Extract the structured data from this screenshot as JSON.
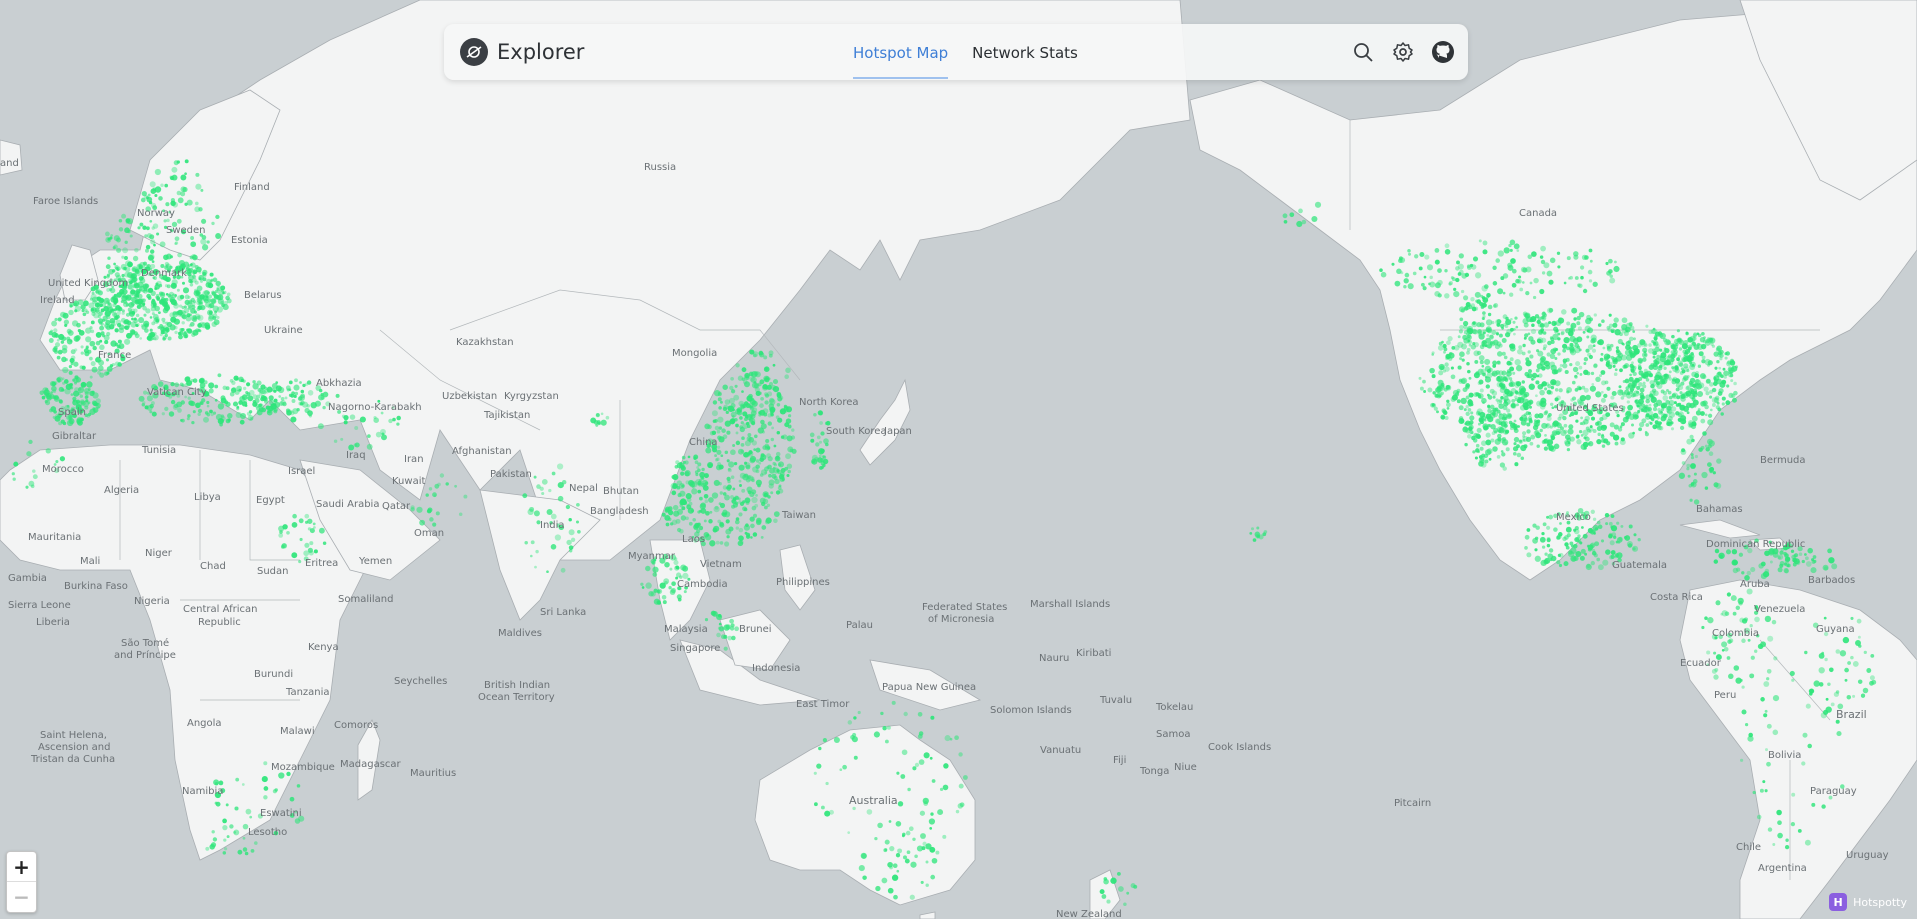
{
  "app": {
    "title": "Explorer",
    "tabs": [
      {
        "label": "Hotspot Map",
        "active": true
      },
      {
        "label": "Network Stats",
        "active": false
      }
    ],
    "actions": [
      "search-icon",
      "gear-icon",
      "github-icon"
    ]
  },
  "colors": {
    "ocean": "#c9cfd2",
    "land": "#f3f4f4",
    "border": "#a9aeb2",
    "hotspot": "#2ee57a",
    "accent": "#3f7fd6"
  },
  "zoom": {
    "in_label": "+",
    "out_label": "−"
  },
  "attribution": {
    "logo_letter": "H",
    "text": "Hotspotty"
  },
  "place_labels": {
    "russia": "Russia",
    "canada": "Canada",
    "faroe": "Faroe Islands",
    "finland": "Finland",
    "norway": "Norway",
    "sweden": "Sweden",
    "estonia": "Estonia",
    "uk": "United Kingdom",
    "ireland": "Ireland",
    "denmark": "Denmark",
    "belarus": "Belarus",
    "ukraine": "Ukraine",
    "france": "France",
    "spain": "Spain",
    "abkhazia": "Abkhazia",
    "nagorno": "Nagorno-Karabakh",
    "kazakhstan": "Kazakhstan",
    "mongolia": "Mongolia",
    "uzbekistan": "Uzbekistan",
    "kyrgyzstan": "Kyrgyzstan",
    "tajikistan": "Tajikistan",
    "north_korea": "North Korea",
    "south_korea": "South Korea",
    "japan": "Japan",
    "china": "China",
    "tunisia": "Tunisia",
    "morocco": "Morocco",
    "algeria": "Algeria",
    "libya": "Libya",
    "egypt": "Egypt",
    "iraq": "Iraq",
    "iran": "Iran",
    "afghanistan": "Afghanistan",
    "pakistan": "Pakistan",
    "israel": "Israel",
    "kuwait": "Kuwait",
    "saudi": "Saudi Arabia",
    "qatar": "Qatar",
    "oman": "Oman",
    "nepal": "Nepal",
    "bhutan": "Bhutan",
    "bangladesh": "Bangladesh",
    "india": "India",
    "taiwan": "Taiwan",
    "laos": "Laos",
    "myanmar": "Myanmar",
    "vietnam": "Vietnam",
    "cambodia": "Cambodia",
    "philippines": "Philippines",
    "mauritania": "Mauritania",
    "mali": "Mali",
    "niger": "Niger",
    "chad": "Chad",
    "sudan": "Sudan",
    "eritrea": "Eritrea",
    "yemen": "Yemen",
    "somaliland": "Somaliland",
    "gambia": "Gambia",
    "burkina": "Burkina Faso",
    "nigeria": "Nigeria",
    "sierra": "Sierra Leone",
    "liberia": "Liberia",
    "car1": "Central African",
    "car2": "Republic",
    "sao1": "São Tomé",
    "sao2": "and Príncipe",
    "kenya": "Kenya",
    "burundi": "Burundi",
    "tanzania": "Tanzania",
    "angola": "Angola",
    "malawi": "Malawi",
    "comoros": "Comoros",
    "mozambique": "Mozambique",
    "madagascar": "Madagascar",
    "mauritius": "Mauritius",
    "namibia": "Namibia",
    "eswatini": "Eswatini",
    "lesotho": "Lesotho",
    "saint1": "Saint Helena,",
    "saint2": "Ascension and",
    "saint3": "Tristan da Cunha",
    "seychelles": "Seychelles",
    "biot1": "British Indian",
    "biot2": "Ocean Territory",
    "maldives": "Maldives",
    "srilanka": "Sri Lanka",
    "malaysia": "Malaysia",
    "brunei": "Brunei",
    "singapore": "Singapore",
    "indonesia": "Indonesia",
    "easttimor": "East Timor",
    "palau": "Palau",
    "fsm1": "Federated States",
    "fsm2": "of Micronesia",
    "marshall": "Marshall Islands",
    "nauru": "Nauru",
    "kiribati": "Kiribati",
    "png": "Papua New Guinea",
    "solomon": "Solomon Islands",
    "tuvalu": "Tuvalu",
    "tokelau": "Tokelau",
    "vanuatu": "Vanuatu",
    "samoa": "Samoa",
    "cook": "Cook Islands",
    "fiji": "Fiji",
    "tonga": "Tonga",
    "niue": "Niue",
    "australia": "Australia",
    "nz": "New Zealand",
    "pitcairn": "Pitcairn",
    "usa": "United States",
    "bermuda": "Bermuda",
    "bahamas": "Bahamas",
    "mexico": "Mexico",
    "dominican": "Dominican Republic",
    "guatemala": "Guatemala",
    "aruba": "Aruba",
    "barbados": "Barbados",
    "costarica": "Costa Rica",
    "venezuela": "Venezuela",
    "colombia": "Colombia",
    "guyana": "Guyana",
    "ecuador": "Ecuador",
    "peru": "Peru",
    "brazil": "Brazil",
    "bolivia": "Bolivia",
    "paraguay": "Paraguay",
    "chile": "Chile",
    "uruguay": "Uruguay",
    "argentina": "Argentina",
    "vatican": "Vatican City",
    "gibraltar": "Gibraltar",
    "iceland_fragment": "and"
  }
}
